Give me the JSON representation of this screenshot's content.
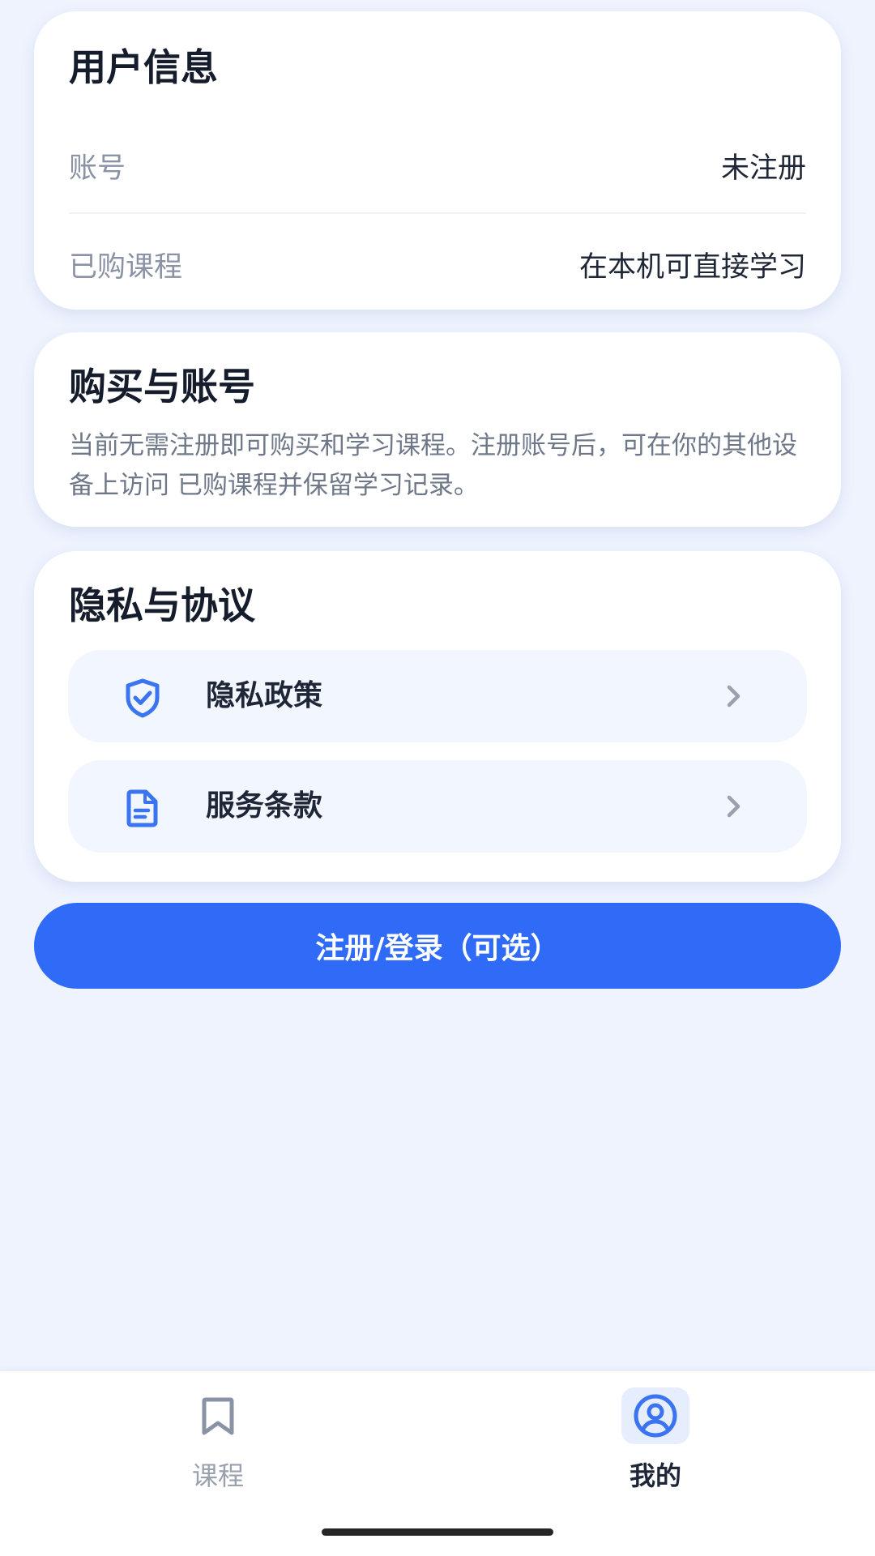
{
  "user_info": {
    "title": "用户信息",
    "rows": [
      {
        "label": "账号",
        "value": "未注册"
      },
      {
        "label": "已购课程",
        "value": "在本机可直接学习"
      }
    ]
  },
  "purchase": {
    "title": "购买与账号",
    "description": "当前无需注册即可购买和学习课程。注册账号后，可在你的其他设备上访问 已购课程并保留学习记录。"
  },
  "privacy": {
    "title": "隐私与协议",
    "items": [
      {
        "label": "隐私政策",
        "icon": "shield-check-icon"
      },
      {
        "label": "服务条款",
        "icon": "document-icon"
      }
    ]
  },
  "primary_button": {
    "label": "注册/登录（可选）"
  },
  "tab_bar": {
    "tabs": [
      {
        "label": "课程",
        "icon": "bookmark-icon",
        "active": false
      },
      {
        "label": "我的",
        "icon": "user-circle-icon",
        "active": true
      }
    ]
  },
  "colors": {
    "background": "#eef3fe",
    "accent": "#2f6bf6",
    "card": "#ffffff"
  }
}
